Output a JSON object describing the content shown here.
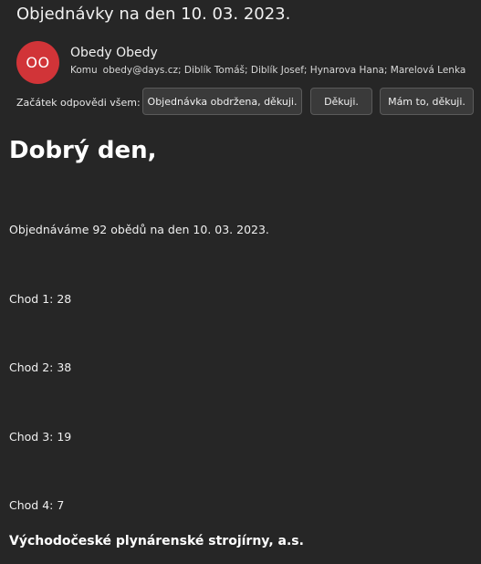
{
  "email": {
    "subject": "Objednávky na den 10. 03. 2023.",
    "sender": {
      "initials": "OO",
      "name": "Obedy Obedy",
      "avatar_color": "#d13438"
    },
    "to_label": "Komu",
    "recipients": "obedy@days.cz; Diblík Tomáš; Diblík Josef; Hynarova Hana; Marelová Lenka"
  },
  "quick_reply": {
    "label": "Začátek odpovědi všem:",
    "options": [
      "Objednávka obdržena, děkuji.",
      "Děkuji.",
      "Mám to, děkuji."
    ]
  },
  "body": {
    "greeting": "Dobrý den,",
    "order_line": "Objednáváme 92 obědů na den 10. 03. 2023.",
    "courses": [
      "Chod 1: 28",
      "Chod 2: 38",
      "Chod 3: 19",
      "Chod 4: 7"
    ],
    "signature": "Východočeské plynárenské strojírny, a.s."
  }
}
